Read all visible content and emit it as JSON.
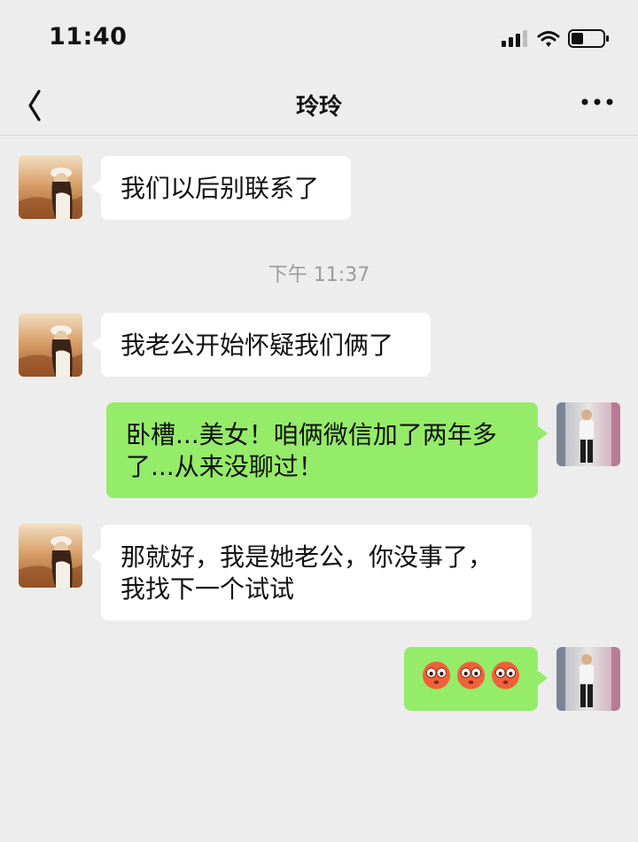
{
  "status_bar": {
    "time": "11:40"
  },
  "nav": {
    "title": "玲玲",
    "back_icon": "chevron-left-icon",
    "more_icon": "more-dots-icon"
  },
  "chat": {
    "timestamp": "下午 11:37",
    "messages": [
      {
        "side": "in",
        "text": "我们以后别联系了"
      },
      {
        "side": "in",
        "text": "我老公开始怀疑我们俩了"
      },
      {
        "side": "out",
        "text": "卧槽...美女！咱俩微信加了两年多了...从来没聊过！"
      },
      {
        "side": "in",
        "text": "那就好，我是她老公，你没事了，我找下一个试试"
      },
      {
        "side": "out",
        "emoji": [
          "flushed-face-emoji",
          "flushed-face-emoji",
          "flushed-face-emoji"
        ]
      }
    ]
  },
  "colors": {
    "background": "#ededed",
    "incoming_bubble": "#ffffff",
    "outgoing_bubble": "#95ec69"
  }
}
